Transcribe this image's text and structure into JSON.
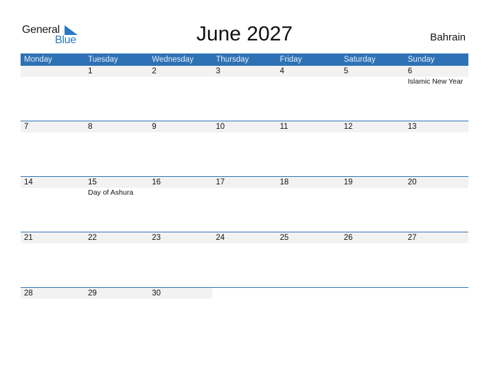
{
  "logo": {
    "line1": "General",
    "line2": "Blue",
    "icon": "triangle-flag-icon"
  },
  "title": "June 2027",
  "country": "Bahrain",
  "colors": {
    "accent": "#2e72b5",
    "date_row_bg": "#f2f2f2"
  },
  "weekdays": [
    "Monday",
    "Tuesday",
    "Wednesday",
    "Thursday",
    "Friday",
    "Saturday",
    "Sunday"
  ],
  "weeks": [
    {
      "days": [
        "",
        "1",
        "2",
        "3",
        "4",
        "5",
        "6"
      ],
      "events": [
        "",
        "",
        "",
        "",
        "",
        "",
        "Islamic New Year"
      ]
    },
    {
      "days": [
        "7",
        "8",
        "9",
        "10",
        "11",
        "12",
        "13"
      ],
      "events": [
        "",
        "",
        "",
        "",
        "",
        "",
        ""
      ]
    },
    {
      "days": [
        "14",
        "15",
        "16",
        "17",
        "18",
        "19",
        "20"
      ],
      "events": [
        "",
        "Day of Ashura",
        "",
        "",
        "",
        "",
        ""
      ]
    },
    {
      "days": [
        "21",
        "22",
        "23",
        "24",
        "25",
        "26",
        "27"
      ],
      "events": [
        "",
        "",
        "",
        "",
        "",
        "",
        ""
      ]
    },
    {
      "days": [
        "28",
        "29",
        "30",
        "",
        "",
        "",
        ""
      ],
      "events": [
        "",
        "",
        "",
        "",
        "",
        "",
        ""
      ]
    }
  ]
}
